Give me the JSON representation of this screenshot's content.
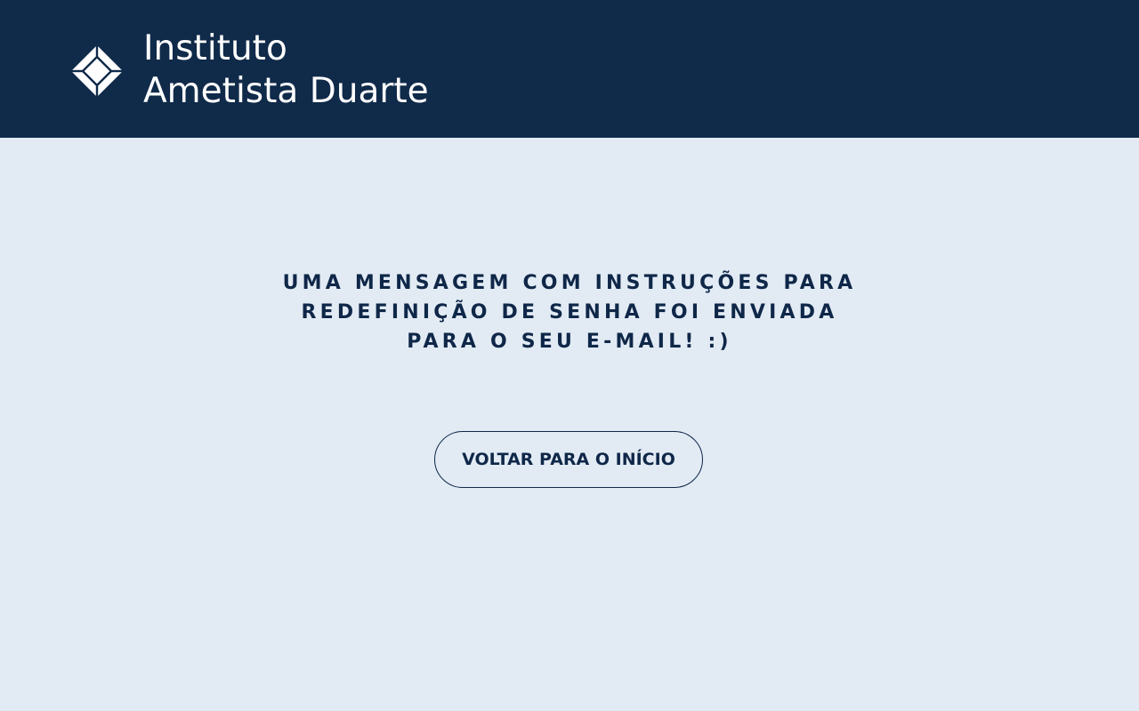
{
  "header": {
    "logo_icon": "diamond-logo-icon",
    "brand_line1": "Instituto",
    "brand_line2": "Ametista Duarte"
  },
  "main": {
    "message_lines": [
      "UMA MENSAGEM COM INSTRUÇÕES PARA",
      "REDEFINIÇÃO DE SENHA FOI ENVIADA",
      "PARA O SEU E-MAIL! :)"
    ],
    "back_button_label": "VOLTAR PARA O INÍCIO"
  },
  "colors": {
    "header_bg": "#102a49",
    "page_bg": "#e2ebf4",
    "text_dark": "#0f2748",
    "text_light": "#ffffff"
  }
}
